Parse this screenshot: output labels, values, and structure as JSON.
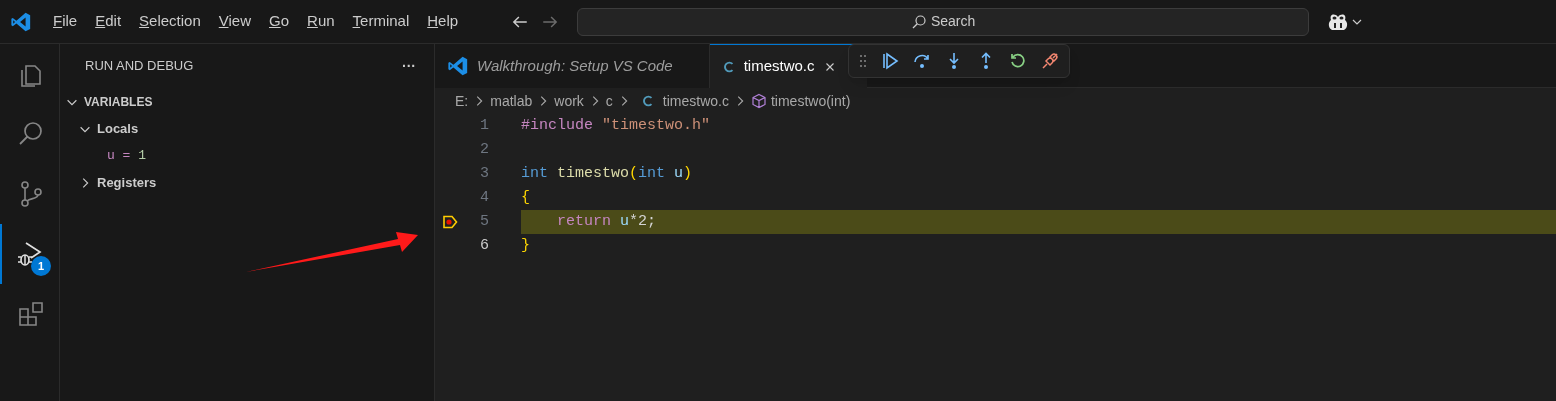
{
  "menu": [
    {
      "label": "File"
    },
    {
      "label": "Edit"
    },
    {
      "label": "Selection"
    },
    {
      "label": "View"
    },
    {
      "label": "Go"
    },
    {
      "label": "Run"
    },
    {
      "label": "Terminal"
    },
    {
      "label": "Help"
    }
  ],
  "search": {
    "placeholder": "Search"
  },
  "activity_bar": [
    {
      "kind": "explorer",
      "selected": false
    },
    {
      "kind": "search",
      "selected": false
    },
    {
      "kind": "scm",
      "selected": false
    },
    {
      "kind": "debug",
      "selected": true,
      "badge": "1"
    },
    {
      "kind": "extensions",
      "selected": false
    }
  ],
  "sidebar": {
    "title": "RUN AND DEBUG",
    "more": "···",
    "sections": [
      {
        "label": "VARIABLES",
        "expanded": true,
        "children": [
          {
            "label": "Locals",
            "expanded": true,
            "children": [
              {
                "name": "u",
                "separator": "=",
                "value": "1"
              }
            ]
          },
          {
            "label": "Registers",
            "expanded": false
          }
        ]
      }
    ]
  },
  "tabs": [
    {
      "label": "Walkthrough: Setup VS Code",
      "kind": "walkthrough",
      "selected": false
    },
    {
      "label": "timestwo.c",
      "kind": "c",
      "selected": true
    }
  ],
  "breadcrumb": [
    {
      "text": "E:",
      "kind": "folder"
    },
    {
      "text": "matlab",
      "kind": "folder"
    },
    {
      "text": "work",
      "kind": "folder"
    },
    {
      "text": "c",
      "kind": "folder"
    },
    {
      "text": "timestwo.c",
      "kind": "c"
    },
    {
      "text": "timestwo(int)",
      "kind": "symbol"
    }
  ],
  "code": [
    {
      "number": "1",
      "current": false,
      "active": false,
      "tokens": [
        {
          "text": "#include",
          "kind": "directive"
        },
        {
          "text": " \"timestwo.h\"",
          "kind": "string"
        }
      ]
    },
    {
      "number": "2",
      "current": false,
      "active": false
    },
    {
      "number": "3",
      "current": false,
      "active": false,
      "tokens": [
        {
          "text": "int",
          "kind": "keyword"
        },
        {
          "text": " timestwo",
          "kind": "function"
        },
        {
          "text": "(",
          "kind": "bracket"
        },
        {
          "text": "int",
          "kind": "keyword"
        },
        {
          "text": " u",
          "kind": "variable"
        },
        {
          "text": ")",
          "kind": "bracket"
        }
      ]
    },
    {
      "number": "4",
      "current": false,
      "active": false,
      "tokens": [
        {
          "text": "{",
          "kind": "bracket"
        }
      ]
    },
    {
      "number": "5",
      "current": true,
      "active": false,
      "tokens": [
        {
          "text": "    return",
          "kind": "control"
        },
        {
          "text": " u",
          "kind": "variable"
        },
        {
          "text": "*2;",
          "kind": "plain"
        }
      ]
    },
    {
      "number": "6",
      "current": false,
      "active": true,
      "tokens": [
        {
          "text": "}",
          "kind": "bracket"
        }
      ]
    }
  ]
}
